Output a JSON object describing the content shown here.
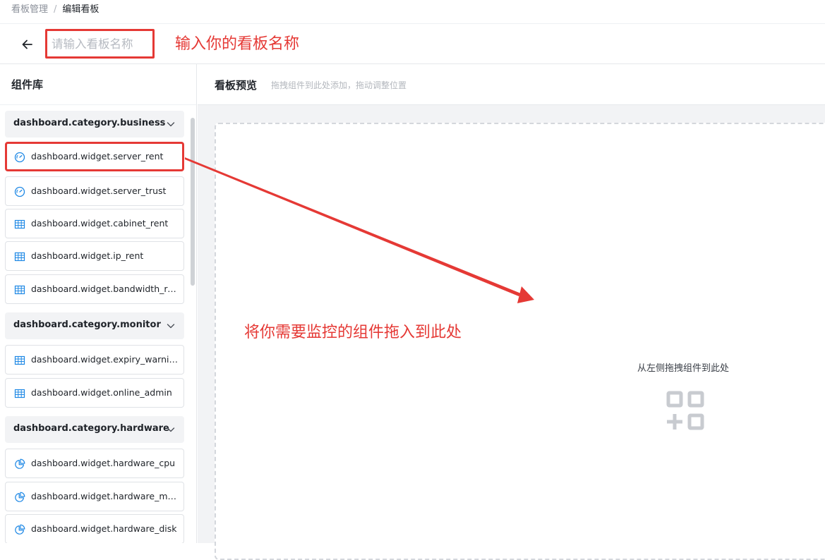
{
  "breadcrumb": {
    "root": "看板管理",
    "separator": "/",
    "current": "编辑看板"
  },
  "header": {
    "name_input": {
      "value": "",
      "placeholder": "请输入看板名称"
    },
    "name_annotation": "输入你的看板名称"
  },
  "library": {
    "title": "组件库",
    "categories": [
      {
        "label": "dashboard.category.business",
        "items": [
          {
            "label": "dashboard.widget.server_rent",
            "icon": "gauge-icon"
          },
          {
            "label": "dashboard.widget.server_trust",
            "icon": "gauge-icon"
          },
          {
            "label": "dashboard.widget.cabinet_rent",
            "icon": "table-icon"
          },
          {
            "label": "dashboard.widget.ip_rent",
            "icon": "table-icon"
          },
          {
            "label": "dashboard.widget.bandwidth_rent",
            "icon": "table-icon"
          }
        ]
      },
      {
        "label": "dashboard.category.monitor",
        "items": [
          {
            "label": "dashboard.widget.expiry_warning",
            "icon": "table-icon"
          },
          {
            "label": "dashboard.widget.online_admin",
            "icon": "table-icon"
          }
        ]
      },
      {
        "label": "dashboard.category.hardware",
        "items": [
          {
            "label": "dashboard.widget.hardware_cpu",
            "icon": "pie-chart-icon"
          },
          {
            "label": "dashboard.widget.hardware_memory",
            "icon": "pie-chart-icon"
          },
          {
            "label": "dashboard.widget.hardware_disk",
            "icon": "pie-chart-icon"
          }
        ]
      }
    ]
  },
  "preview": {
    "title": "看板预览",
    "hint": "拖拽组件到此处添加，拖动调整位置",
    "empty_text": "从左侧拖拽组件到此处",
    "drop_annotation": "将你需要监控的组件拖入到此处"
  },
  "colors": {
    "annotation_red": "#e53935",
    "icon_blue": "#1e88e5",
    "empty_icon_gray": "#c8cbd0"
  }
}
